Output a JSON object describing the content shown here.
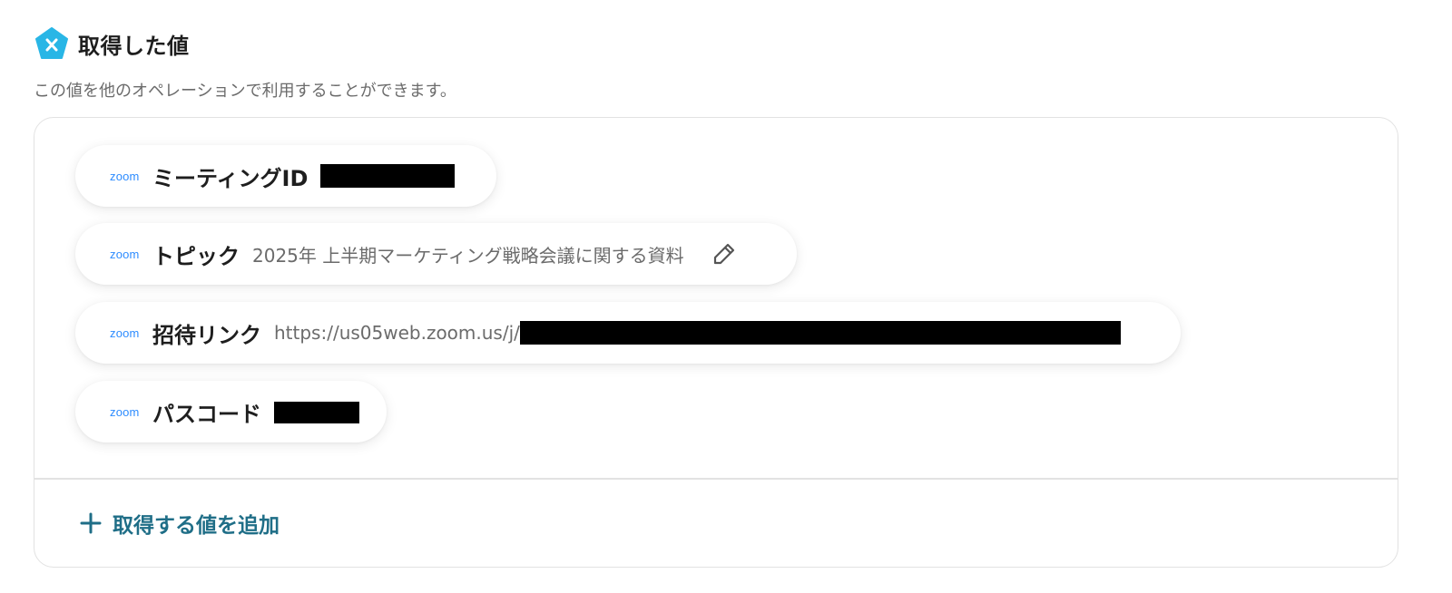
{
  "header": {
    "title": "取得した値",
    "icon": "variable-x-icon",
    "icon_color": "#29b6e6"
  },
  "subtitle": "この値を他のオペレーションで利用することができます。",
  "values": [
    {
      "app": "zoom",
      "label": "ミーティングID",
      "value": "",
      "redacted": true
    },
    {
      "app": "zoom",
      "label": "トピック",
      "value": "2025年 上半期マーケティング戦略会議に関する資料",
      "editable": true
    },
    {
      "app": "zoom",
      "label": "招待リンク",
      "value": "https://us05web.zoom.us/j/",
      "redacted": true
    },
    {
      "app": "zoom",
      "label": "パスコード",
      "value": "",
      "redacted": true
    }
  ],
  "add_button": {
    "label": "取得する値を追加",
    "color": "#1f6e87"
  },
  "colors": {
    "zoom_brand": "#2d8cff",
    "border": "#e2e2e2",
    "muted_text": "#6b6b6b"
  }
}
